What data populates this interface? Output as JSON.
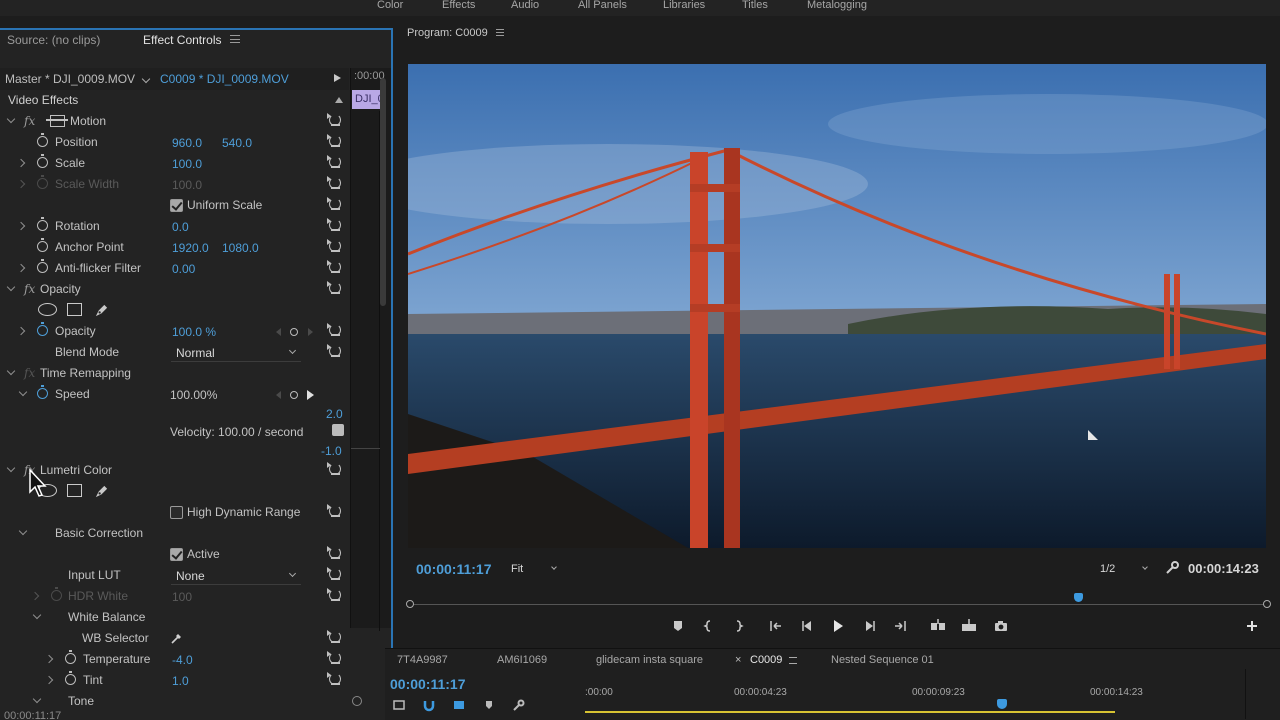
{
  "workspaces": [
    "Color",
    "Effects",
    "Audio",
    "All Panels",
    "Libraries",
    "Titles",
    "Metalogging"
  ],
  "effect_controls": {
    "tab_source": "Source: (no clips)",
    "tab_effect_controls": "Effect Controls",
    "master_clip": "Master * DJI_0009.MOV",
    "sequence_clip": "C0009 * DJI_0009.MOV",
    "mini_timecode": ":00:00",
    "mini_clip_label": "DJI_0",
    "video_effects": "Video Effects",
    "motion": {
      "name": "Motion",
      "position_label": "Position",
      "position_x": "960.0",
      "position_y": "540.0",
      "scale_label": "Scale",
      "scale_value": "100.0",
      "scale_width_label": "Scale Width",
      "scale_width_value": "100.0",
      "uniform_scale_label": "Uniform Scale",
      "uniform_scale_checked": true,
      "rotation_label": "Rotation",
      "rotation_value": "0.0",
      "anchor_label": "Anchor Point",
      "anchor_x": "1920.0",
      "anchor_y": "1080.0",
      "antiflicker_label": "Anti-flicker Filter",
      "antiflicker_value": "0.00"
    },
    "opacity": {
      "name": "Opacity",
      "opacity_label": "Opacity",
      "opacity_value": "100.0 %",
      "blend_label": "Blend Mode",
      "blend_value": "Normal"
    },
    "time_remapping": {
      "name": "Time Remapping",
      "speed_label": "Speed",
      "speed_value": "100.00%",
      "graph_max": "2.0",
      "velocity": "Velocity: 100.00 / second",
      "graph_min": "-1.0"
    },
    "lumetri": {
      "name": "Lumetri Color",
      "hdr_label": "High Dynamic Range",
      "hdr_checked": false,
      "basic_correction": "Basic Correction",
      "active_label": "Active",
      "active_checked": true,
      "input_lut_label": "Input LUT",
      "input_lut_value": "None",
      "hdr_white_label": "HDR White",
      "hdr_white_value": "100",
      "white_balance": "White Balance",
      "wb_selector": "WB Selector",
      "temperature_label": "Temperature",
      "temperature_value": "-4.0",
      "tint_label": "Tint",
      "tint_value": "1.0",
      "tone": "Tone"
    },
    "footer_timecode": "00:00:11:17"
  },
  "program": {
    "title": "Program: C0009",
    "timecode_current": "00:00:11:17",
    "zoom": "Fit",
    "resolution": "1/2",
    "timecode_duration": "00:00:14:23",
    "playhead_fraction": 0.78
  },
  "timeline": {
    "tabs": [
      "7T4A9987",
      "AM6I1069",
      "glidecam insta square",
      "C0009",
      "Nested Sequence 01"
    ],
    "active_tab": "C0009",
    "timecode": "00:00:11:17",
    "ruler": [
      ":00:00",
      "00:00:04:23",
      "00:00:09:23",
      "00:00:14:23"
    ]
  },
  "colors": {
    "accent": "#4e9ed8",
    "panel_border": "#2a74b4",
    "clip_purple": "#b9a8e6"
  }
}
